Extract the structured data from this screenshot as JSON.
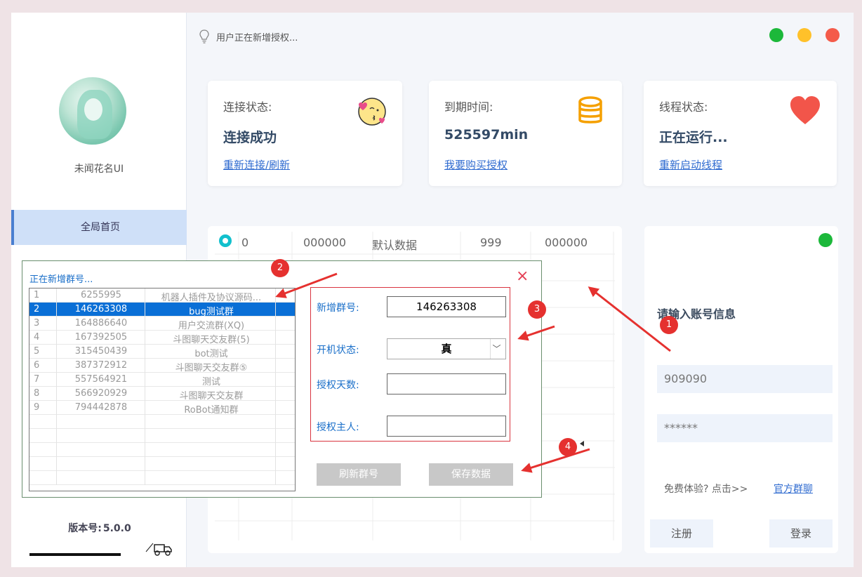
{
  "status_hint": "用户正在新增授权...",
  "window_dots": {
    "green": "#1cb83a",
    "yellow": "#ffc12a",
    "red": "#f45b4a"
  },
  "sidebar": {
    "username": "未闻花名UI",
    "nav_home": "全局首页",
    "version_label": "版本号:",
    "version_value": "5.0.0"
  },
  "cards": [
    {
      "label": "连接状态:",
      "value": "连接成功",
      "link": "重新连接/刷新",
      "icon": "kiss-face-icon"
    },
    {
      "label": "到期时间:",
      "value": "525597min",
      "link": "我要购买授权",
      "icon": "database-icon"
    },
    {
      "label": "线程状态:",
      "value": "正在运行...",
      "link": "重新启动线程",
      "icon": "heart-icon"
    }
  ],
  "grid": {
    "row0": [
      "0",
      "000000",
      "默认数据",
      "999",
      "000000"
    ]
  },
  "login": {
    "title": "请输入账号信息",
    "account": "909090",
    "password": "******",
    "free_text": "免费体验? 点击>>",
    "official_link": "官方群聊",
    "register": "注册",
    "login": "登录"
  },
  "dialog": {
    "title": "正在新增群号...",
    "close": "×",
    "groups": [
      {
        "idx": "1",
        "id": "6255995",
        "name": "机器人插件及协议源码..."
      },
      {
        "idx": "2",
        "id": "146263308",
        "name": "bug测试群",
        "selected": true
      },
      {
        "idx": "3",
        "id": "164886640",
        "name": "用户交流群(XQ)"
      },
      {
        "idx": "4",
        "id": "167392505",
        "name": "斗图聊天交友群(5)"
      },
      {
        "idx": "5",
        "id": "315450439",
        "name": "bot测试"
      },
      {
        "idx": "6",
        "id": "387372912",
        "name": "斗图聊天交友群⑤"
      },
      {
        "idx": "7",
        "id": "557564921",
        "name": "测试"
      },
      {
        "idx": "8",
        "id": "566920929",
        "name": "斗图聊天交友群"
      },
      {
        "idx": "9",
        "id": "794442878",
        "name": "RoBot通知群"
      }
    ],
    "form": {
      "group_label": "新增群号:",
      "group_value": "146263308",
      "boot_label": "开机状态:",
      "boot_value": "真",
      "days_label": "授权天数:",
      "days_value": "",
      "owner_label": "授权主人:",
      "owner_value": ""
    },
    "refresh_btn": "刷新群号",
    "save_btn": "保存数据"
  },
  "badges": [
    "1",
    "2",
    "3",
    "4"
  ]
}
